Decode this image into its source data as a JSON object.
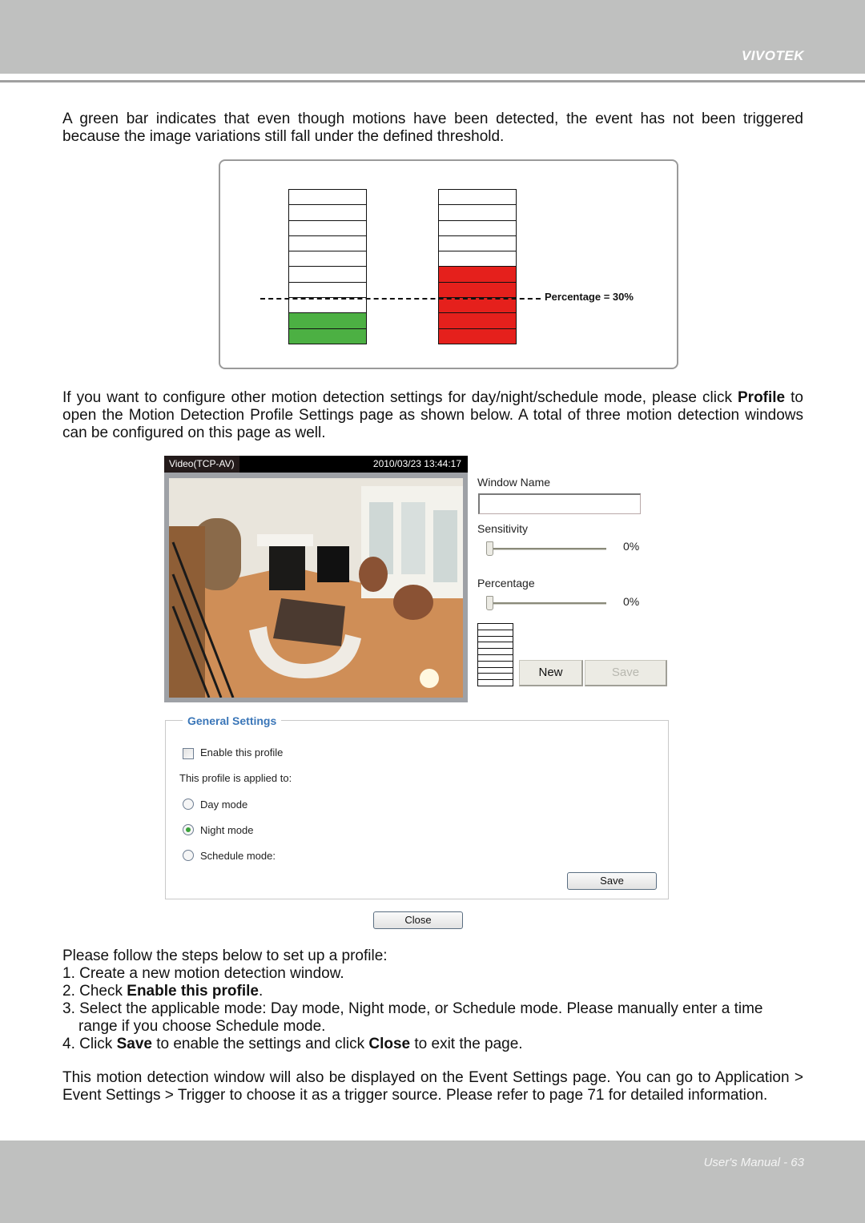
{
  "header": {
    "brand": "VIVOTEK"
  },
  "intro_paragraph": "A green bar indicates that even though motions have been detected, the event has not been triggered because the image variations still fall under the defined threshold.",
  "diagram": {
    "segments_per_bar": 10,
    "threshold_percent": 30,
    "threshold_label": "Percentage = 30%",
    "bars": [
      {
        "name": "below-threshold",
        "filled_segments": 2,
        "fill_color": "#4cb043"
      },
      {
        "name": "above-threshold",
        "filled_segments": 5,
        "fill_color": "#e5201c"
      }
    ],
    "empty_color": "#ffffff"
  },
  "profile_paragraph": {
    "part1": "If you want to configure other motion detection settings for day/night/schedule mode, please click ",
    "bold": "Profile",
    "part2": " to open the Motion Detection Profile Settings page as shown below. A total of three motion detection windows can be configured on this page as well."
  },
  "video": {
    "title": "Video(TCP-AV)",
    "timestamp": "2010/03/23 13:44:17"
  },
  "motion_panel": {
    "window_name_label": "Window Name",
    "window_name_value": "",
    "sensitivity_label": "Sensitivity",
    "sensitivity_value": "0%",
    "sensitivity_level": 0,
    "percentage_label": "Percentage",
    "percentage_value": "0%",
    "percentage_level": 0,
    "meter_segments": 10,
    "new_button": "New",
    "save_button": "Save"
  },
  "general_settings": {
    "legend": "General Settings",
    "enable_label": "Enable this profile",
    "enable_checked": false,
    "applied_to_label": "This profile is applied to:",
    "modes": [
      {
        "label": "Day mode",
        "checked": false
      },
      {
        "label": "Night mode",
        "checked": true
      },
      {
        "label": "Schedule mode:",
        "checked": false
      }
    ],
    "save_button": "Save"
  },
  "close_button": "Close",
  "steps": {
    "intro": "Please follow the steps below to set up a profile:",
    "step1": "1. Create a new motion detection window.",
    "step2_prefix": "2. Check ",
    "step2_bold": "Enable this profile",
    "step2_suffix": ".",
    "step3_line1": "3. Select the applicable mode: Day mode, Night mode, or Schedule mode. Please manually enter a time",
    "step3_line2": "range if you choose Schedule mode.",
    "step4_a": "4. Click ",
    "step4_b": "Save",
    "step4_c": " to enable the settings and click ",
    "step4_d": "Close",
    "step4_e": " to exit the page."
  },
  "closing_paragraph": "This motion detection window will also be displayed on the Event Settings page. You can go to Application > Event Settings > Trigger to choose it as a trigger source. Please refer to page 71 for detailed information.",
  "footer": {
    "page_label": "User's Manual - 63"
  }
}
